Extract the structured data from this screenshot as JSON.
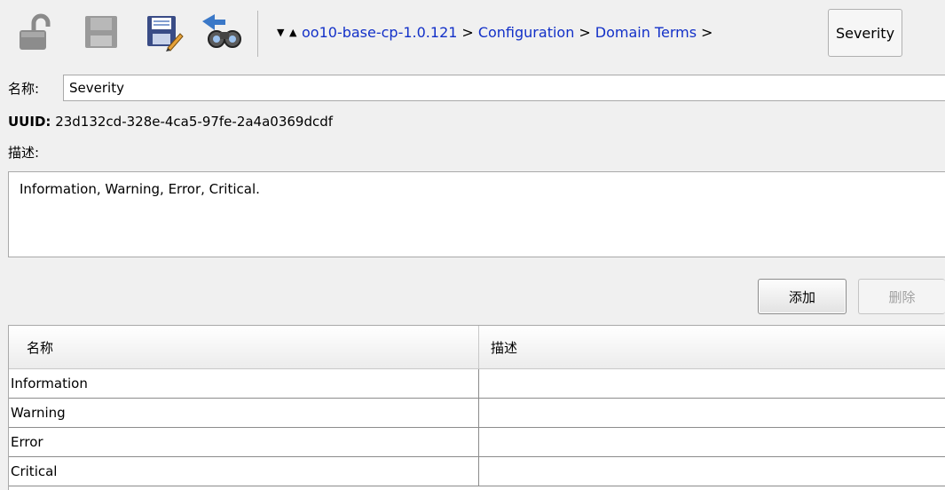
{
  "toolbar": {
    "icons": [
      "unlock-icon",
      "save-disabled-icon",
      "save-edit-icon",
      "find-binoculars-icon"
    ]
  },
  "breadcrumb": {
    "items": [
      "oo10-base-cp-1.0.121",
      "Configuration",
      "Domain Terms"
    ],
    "separator": ">",
    "current": "Severity"
  },
  "form": {
    "name_label": "名称:",
    "name_value": "Severity",
    "uuid_label": "UUID:",
    "uuid_value": "23d132cd-328e-4ca5-97fe-2a4a0369dcdf",
    "desc_label": "描述:",
    "desc_value": "Information, Warning, Error, Critical."
  },
  "buttons": {
    "add": "添加",
    "delete": "删除"
  },
  "table": {
    "columns": [
      "名称",
      "描述"
    ],
    "rows": [
      {
        "name": "Information",
        "desc": ""
      },
      {
        "name": "Warning",
        "desc": ""
      },
      {
        "name": "Error",
        "desc": ""
      },
      {
        "name": "Critical",
        "desc": ""
      }
    ]
  }
}
